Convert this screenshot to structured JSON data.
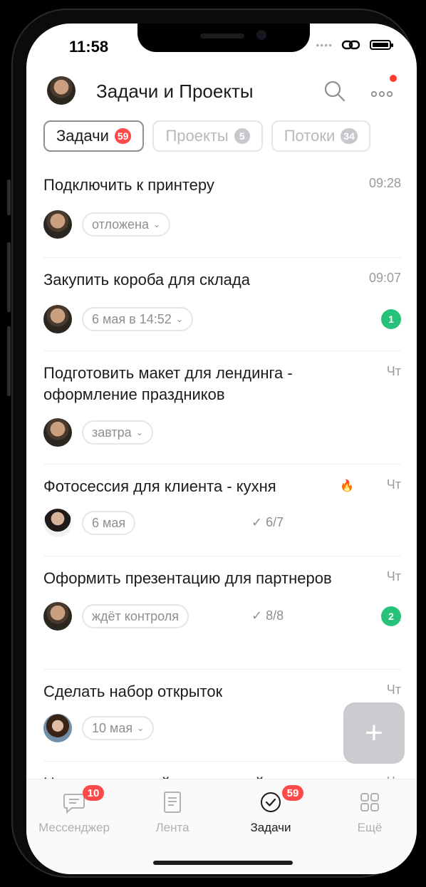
{
  "status_bar": {
    "time": "11:58"
  },
  "header": {
    "title": "Задачи и Проекты"
  },
  "tabs": [
    {
      "label": "Задачи",
      "count": "59"
    },
    {
      "label": "Проекты",
      "count": "5"
    },
    {
      "label": "Потоки",
      "count": "34"
    }
  ],
  "tasks": [
    {
      "title": "Подключить к принтеру",
      "time": "09:28",
      "chip": "отложена"
    },
    {
      "title": "Закупить короба для склада",
      "time": "09:07",
      "chip": "6 мая в 14:52",
      "badge": "1"
    },
    {
      "title": "Подготовить макет для лендинга - оформление праздников",
      "time": "Чт",
      "chip": "завтра"
    },
    {
      "title": "Фотосессия для клиента - кухня",
      "time": "Чт",
      "chip": "6 мая",
      "checks": "6/7"
    },
    {
      "title": "Оформить презентацию для партнеров",
      "time": "Чт",
      "chip": "ждёт контроля",
      "checks": "8/8",
      "badge": "2"
    },
    {
      "title": "Сделать набор открыток",
      "time": "Чт",
      "chip": "10 мая"
    },
    {
      "title": "Настроить новый процесс найма",
      "time": "Чт"
    }
  ],
  "bottom_nav": [
    {
      "label": "Мессенджер",
      "badge": "10"
    },
    {
      "label": "Лента"
    },
    {
      "label": "Задачи",
      "badge": "59"
    },
    {
      "label": "Ещё"
    }
  ],
  "colors": {
    "badge_red": "#ff4a4a",
    "badge_green": "#27c27a",
    "fire": "#f4a623"
  },
  "icons": [
    "search-icon",
    "more-icon",
    "chevron-down-icon",
    "check-icon",
    "fire-icon",
    "plus-icon",
    "messenger-icon",
    "feed-icon",
    "tasks-icon",
    "grid-icon"
  ]
}
